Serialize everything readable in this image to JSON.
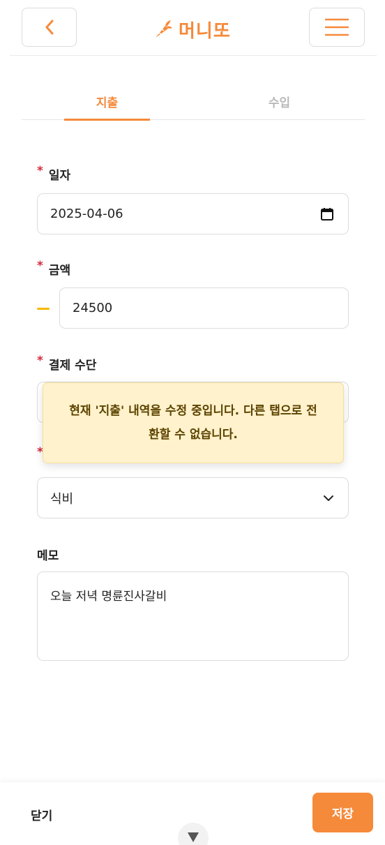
{
  "header": {
    "logo_text": "머니또",
    "back_icon": "chevron-left-icon",
    "menu_icon": "hamburger-menu-icon",
    "logo_icon": "carrot-icon"
  },
  "tabs": [
    {
      "label": "지출",
      "active": true
    },
    {
      "label": "수입",
      "active": false
    }
  ],
  "form": {
    "date": {
      "label": "일자",
      "required": true,
      "value": "2025-04-06",
      "icon": "calendar-icon"
    },
    "amount": {
      "label": "금액",
      "required": true,
      "sign": "minus",
      "value": "24500"
    },
    "payment": {
      "label": "결제 수단",
      "required": true
    },
    "category": {
      "required": true,
      "value": "식비",
      "icon": "chevron-down-icon"
    },
    "memo": {
      "label": "메모",
      "value": "오늘 저녁 명륜진사갈비"
    }
  },
  "toast": {
    "message": "현재 '지출' 내역을 수정 중입니다. 다른 탭으로 전환할 수 없습니다."
  },
  "footer": {
    "close_label": "닫기",
    "save_label": "저장"
  },
  "colors": {
    "accent": "#f58a3a",
    "required": "#d6283b",
    "minus_sign": "#f5b800",
    "toast_bg": "#fff2cc"
  }
}
